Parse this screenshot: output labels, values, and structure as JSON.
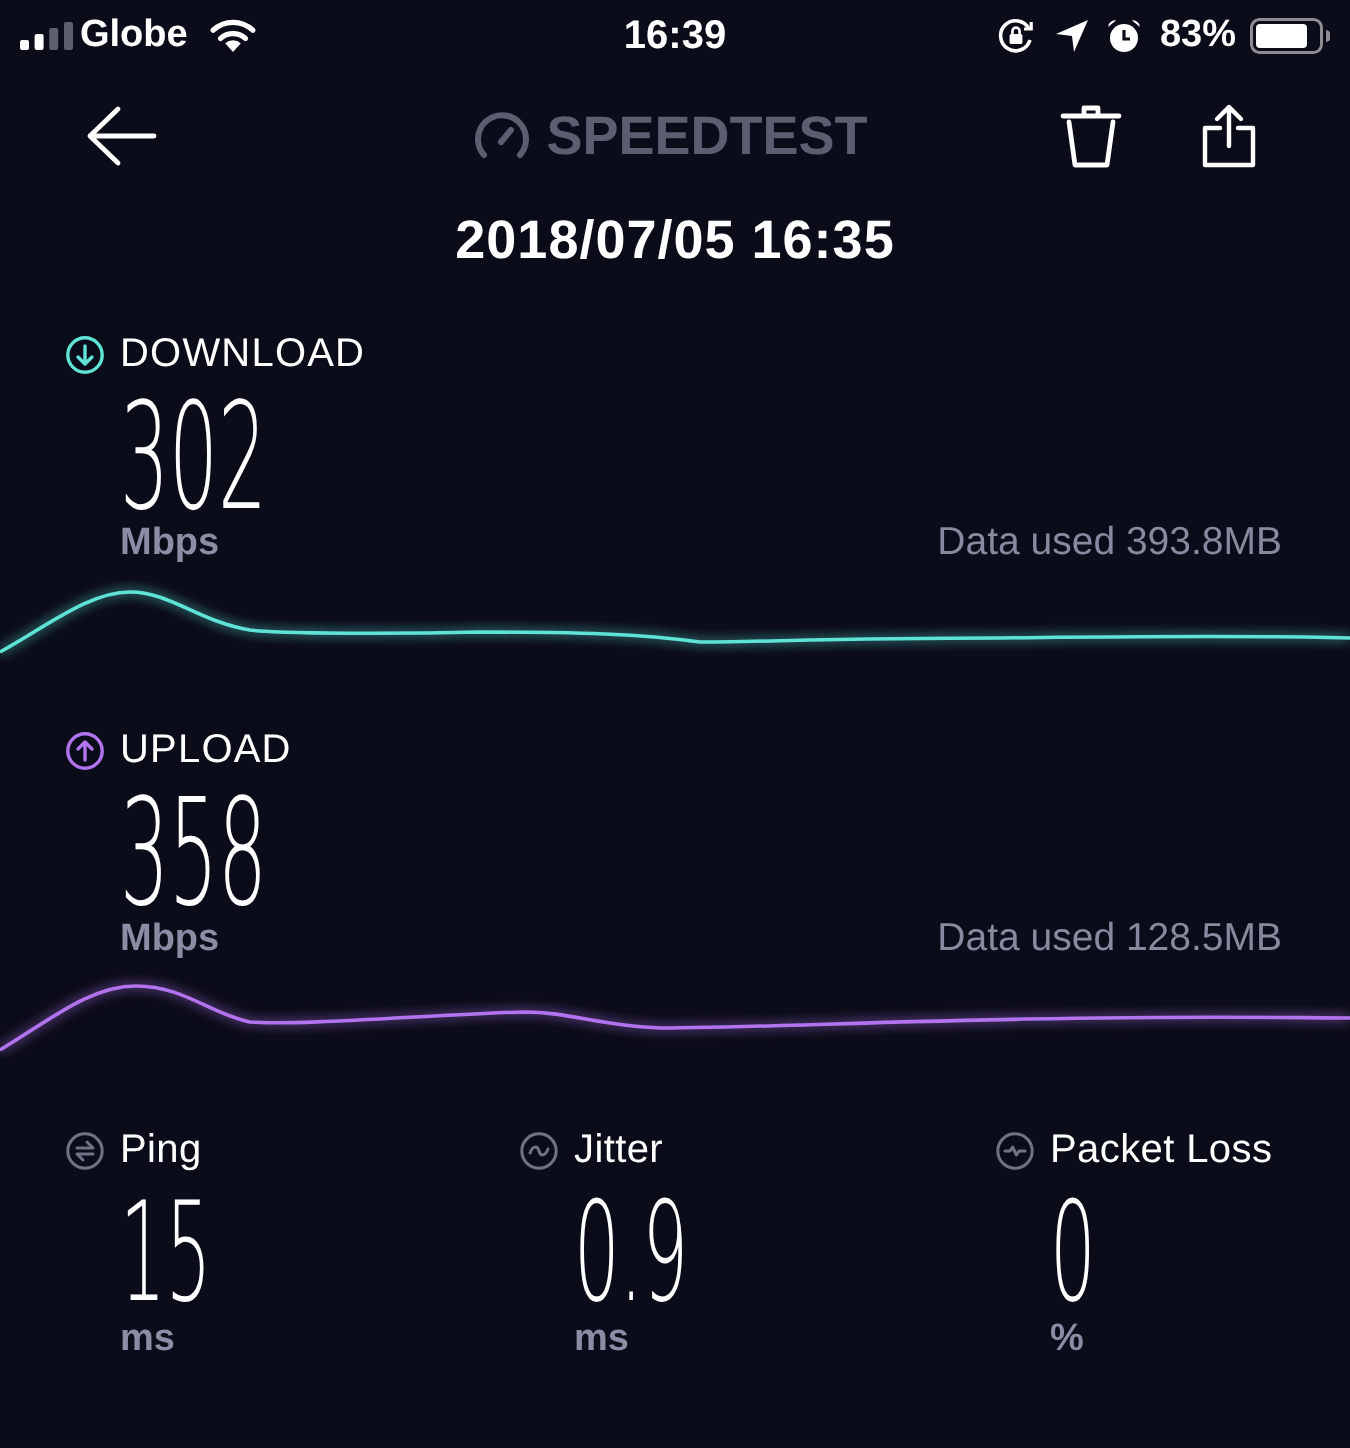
{
  "status_bar": {
    "carrier": "Globe",
    "time": "16:39",
    "battery": "83%"
  },
  "header": {
    "logo": "SPEEDTEST"
  },
  "date": "2018/07/05 16:35",
  "speeds": [
    {
      "kind": "download",
      "label": "DOWNLOAD",
      "value": "302",
      "unit": "Mbps",
      "data_used": "Data used 393.8MB",
      "color": "#5fe3d6"
    },
    {
      "kind": "upload",
      "label": "UPLOAD",
      "value": "358",
      "unit": "Mbps",
      "data_used": "Data used 128.5MB",
      "color": "#b274ee"
    }
  ],
  "metrics": [
    {
      "kind": "ping",
      "label": "Ping",
      "value": "15",
      "unit": "ms"
    },
    {
      "kind": "jitter",
      "label": "Jitter",
      "value": "0.9",
      "unit": "ms"
    },
    {
      "kind": "packet_loss",
      "label": "Packet Loss",
      "value": "0",
      "unit": "%"
    }
  ]
}
